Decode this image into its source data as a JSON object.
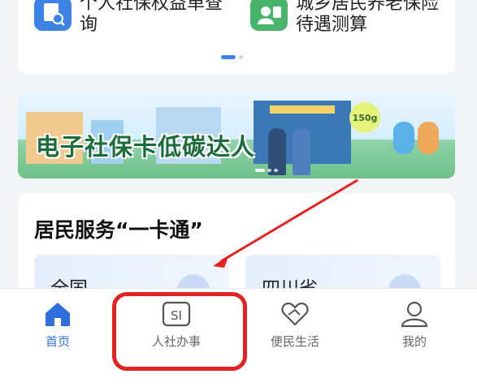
{
  "services": [
    {
      "label": "个人社保权益单查询",
      "icon": "document-search-icon",
      "color": "#3d83e6"
    },
    {
      "label": "城乡居民养老保险待遇测算",
      "icon": "person-id-icon",
      "color": "#47b36b"
    }
  ],
  "banner": {
    "title": "电子社保卡低碳达人",
    "badge": "150g"
  },
  "resident": {
    "title": "居民服务“一卡通”",
    "cards": [
      {
        "label": "全国"
      },
      {
        "label": "四川省"
      }
    ]
  },
  "tabbar": {
    "tabs": [
      {
        "label": "首页",
        "icon": "home-icon",
        "active": true
      },
      {
        "label": "人社办事",
        "icon": "si-icon",
        "active": false
      },
      {
        "label": "便民生活",
        "icon": "heart-hand-icon",
        "active": false
      },
      {
        "label": "我的",
        "icon": "person-icon",
        "active": false
      }
    ]
  },
  "colors": {
    "accent": "#2f6fdb",
    "highlight": "#e32222"
  }
}
